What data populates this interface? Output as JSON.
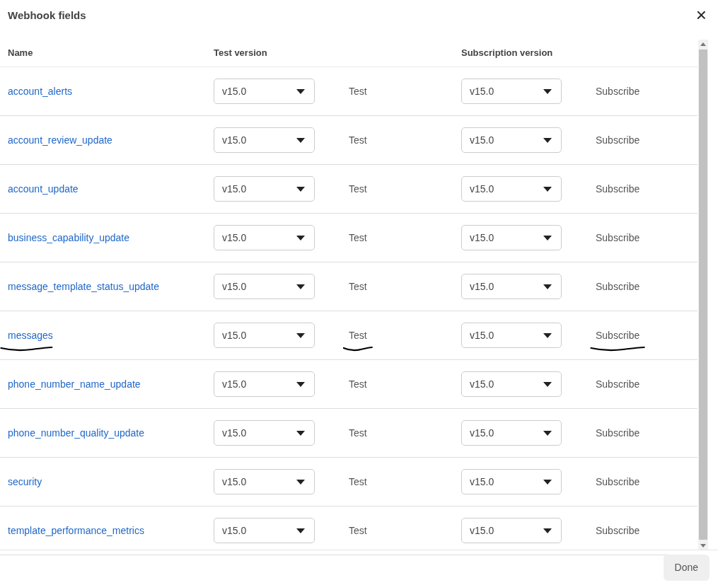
{
  "dialog": {
    "title": "Webhook fields",
    "close": "×"
  },
  "table": {
    "columns": [
      "Name",
      "Test version",
      "Subscription version"
    ],
    "rows": [
      {
        "name": "account_alerts",
        "test_version": "v15.0",
        "test": "Test",
        "subscription_version": "v15.0",
        "subscribe": "Subscribe",
        "marked": false
      },
      {
        "name": "account_review_update",
        "test_version": "v15.0",
        "test": "Test",
        "subscription_version": "v15.0",
        "subscribe": "Subscribe",
        "marked": false
      },
      {
        "name": "account_update",
        "test_version": "v15.0",
        "test": "Test",
        "subscription_version": "v15.0",
        "subscribe": "Subscribe",
        "marked": false
      },
      {
        "name": "business_capability_update",
        "test_version": "v15.0",
        "test": "Test",
        "subscription_version": "v15.0",
        "subscribe": "Subscribe",
        "marked": false
      },
      {
        "name": "message_template_status_update",
        "test_version": "v15.0",
        "test": "Test",
        "subscription_version": "v15.0",
        "subscribe": "Subscribe",
        "marked": false
      },
      {
        "name": "messages",
        "test_version": "v15.0",
        "test": "Test",
        "subscription_version": "v15.0",
        "subscribe": "Subscribe",
        "marked": true
      },
      {
        "name": "phone_number_name_update",
        "test_version": "v15.0",
        "test": "Test",
        "subscription_version": "v15.0",
        "subscribe": "Subscribe",
        "marked": false
      },
      {
        "name": "phone_number_quality_update",
        "test_version": "v15.0",
        "test": "Test",
        "subscription_version": "v15.0",
        "subscribe": "Subscribe",
        "marked": false
      },
      {
        "name": "security",
        "test_version": "v15.0",
        "test": "Test",
        "subscription_version": "v15.0",
        "subscribe": "Subscribe",
        "marked": false
      },
      {
        "name": "template_performance_metrics",
        "test_version": "v15.0",
        "test": "Test",
        "subscription_version": "v15.0",
        "subscribe": "Subscribe",
        "marked": false
      }
    ]
  },
  "footer": {
    "done": "Done"
  }
}
